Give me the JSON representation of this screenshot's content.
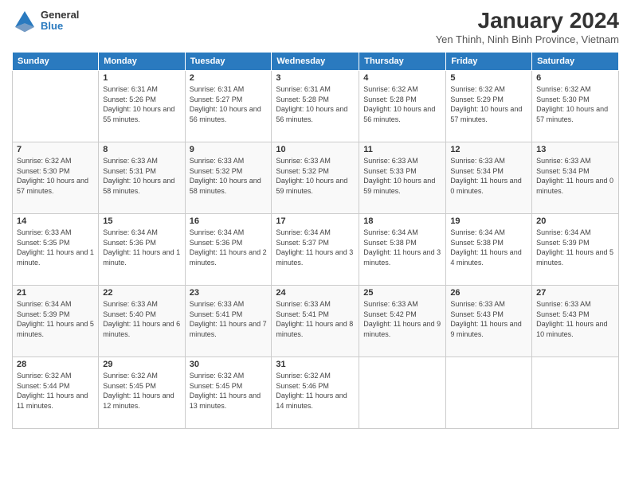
{
  "logo": {
    "general": "General",
    "blue": "Blue"
  },
  "header": {
    "title": "January 2024",
    "location": "Yen Thinh, Ninh Binh Province, Vietnam"
  },
  "days_of_week": [
    "Sunday",
    "Monday",
    "Tuesday",
    "Wednesday",
    "Thursday",
    "Friday",
    "Saturday"
  ],
  "weeks": [
    [
      {
        "day": "",
        "sunrise": "",
        "sunset": "",
        "daylight": ""
      },
      {
        "day": "1",
        "sunrise": "Sunrise: 6:31 AM",
        "sunset": "Sunset: 5:26 PM",
        "daylight": "Daylight: 10 hours and 55 minutes."
      },
      {
        "day": "2",
        "sunrise": "Sunrise: 6:31 AM",
        "sunset": "Sunset: 5:27 PM",
        "daylight": "Daylight: 10 hours and 56 minutes."
      },
      {
        "day": "3",
        "sunrise": "Sunrise: 6:31 AM",
        "sunset": "Sunset: 5:28 PM",
        "daylight": "Daylight: 10 hours and 56 minutes."
      },
      {
        "day": "4",
        "sunrise": "Sunrise: 6:32 AM",
        "sunset": "Sunset: 5:28 PM",
        "daylight": "Daylight: 10 hours and 56 minutes."
      },
      {
        "day": "5",
        "sunrise": "Sunrise: 6:32 AM",
        "sunset": "Sunset: 5:29 PM",
        "daylight": "Daylight: 10 hours and 57 minutes."
      },
      {
        "day": "6",
        "sunrise": "Sunrise: 6:32 AM",
        "sunset": "Sunset: 5:30 PM",
        "daylight": "Daylight: 10 hours and 57 minutes."
      }
    ],
    [
      {
        "day": "7",
        "sunrise": "Sunrise: 6:32 AM",
        "sunset": "Sunset: 5:30 PM",
        "daylight": "Daylight: 10 hours and 57 minutes."
      },
      {
        "day": "8",
        "sunrise": "Sunrise: 6:33 AM",
        "sunset": "Sunset: 5:31 PM",
        "daylight": "Daylight: 10 hours and 58 minutes."
      },
      {
        "day": "9",
        "sunrise": "Sunrise: 6:33 AM",
        "sunset": "Sunset: 5:32 PM",
        "daylight": "Daylight: 10 hours and 58 minutes."
      },
      {
        "day": "10",
        "sunrise": "Sunrise: 6:33 AM",
        "sunset": "Sunset: 5:32 PM",
        "daylight": "Daylight: 10 hours and 59 minutes."
      },
      {
        "day": "11",
        "sunrise": "Sunrise: 6:33 AM",
        "sunset": "Sunset: 5:33 PM",
        "daylight": "Daylight: 10 hours and 59 minutes."
      },
      {
        "day": "12",
        "sunrise": "Sunrise: 6:33 AM",
        "sunset": "Sunset: 5:34 PM",
        "daylight": "Daylight: 11 hours and 0 minutes."
      },
      {
        "day": "13",
        "sunrise": "Sunrise: 6:33 AM",
        "sunset": "Sunset: 5:34 PM",
        "daylight": "Daylight: 11 hours and 0 minutes."
      }
    ],
    [
      {
        "day": "14",
        "sunrise": "Sunrise: 6:33 AM",
        "sunset": "Sunset: 5:35 PM",
        "daylight": "Daylight: 11 hours and 1 minute."
      },
      {
        "day": "15",
        "sunrise": "Sunrise: 6:34 AM",
        "sunset": "Sunset: 5:36 PM",
        "daylight": "Daylight: 11 hours and 1 minute."
      },
      {
        "day": "16",
        "sunrise": "Sunrise: 6:34 AM",
        "sunset": "Sunset: 5:36 PM",
        "daylight": "Daylight: 11 hours and 2 minutes."
      },
      {
        "day": "17",
        "sunrise": "Sunrise: 6:34 AM",
        "sunset": "Sunset: 5:37 PM",
        "daylight": "Daylight: 11 hours and 3 minutes."
      },
      {
        "day": "18",
        "sunrise": "Sunrise: 6:34 AM",
        "sunset": "Sunset: 5:38 PM",
        "daylight": "Daylight: 11 hours and 3 minutes."
      },
      {
        "day": "19",
        "sunrise": "Sunrise: 6:34 AM",
        "sunset": "Sunset: 5:38 PM",
        "daylight": "Daylight: 11 hours and 4 minutes."
      },
      {
        "day": "20",
        "sunrise": "Sunrise: 6:34 AM",
        "sunset": "Sunset: 5:39 PM",
        "daylight": "Daylight: 11 hours and 5 minutes."
      }
    ],
    [
      {
        "day": "21",
        "sunrise": "Sunrise: 6:34 AM",
        "sunset": "Sunset: 5:39 PM",
        "daylight": "Daylight: 11 hours and 5 minutes."
      },
      {
        "day": "22",
        "sunrise": "Sunrise: 6:33 AM",
        "sunset": "Sunset: 5:40 PM",
        "daylight": "Daylight: 11 hours and 6 minutes."
      },
      {
        "day": "23",
        "sunrise": "Sunrise: 6:33 AM",
        "sunset": "Sunset: 5:41 PM",
        "daylight": "Daylight: 11 hours and 7 minutes."
      },
      {
        "day": "24",
        "sunrise": "Sunrise: 6:33 AM",
        "sunset": "Sunset: 5:41 PM",
        "daylight": "Daylight: 11 hours and 8 minutes."
      },
      {
        "day": "25",
        "sunrise": "Sunrise: 6:33 AM",
        "sunset": "Sunset: 5:42 PM",
        "daylight": "Daylight: 11 hours and 9 minutes."
      },
      {
        "day": "26",
        "sunrise": "Sunrise: 6:33 AM",
        "sunset": "Sunset: 5:43 PM",
        "daylight": "Daylight: 11 hours and 9 minutes."
      },
      {
        "day": "27",
        "sunrise": "Sunrise: 6:33 AM",
        "sunset": "Sunset: 5:43 PM",
        "daylight": "Daylight: 11 hours and 10 minutes."
      }
    ],
    [
      {
        "day": "28",
        "sunrise": "Sunrise: 6:32 AM",
        "sunset": "Sunset: 5:44 PM",
        "daylight": "Daylight: 11 hours and 11 minutes."
      },
      {
        "day": "29",
        "sunrise": "Sunrise: 6:32 AM",
        "sunset": "Sunset: 5:45 PM",
        "daylight": "Daylight: 11 hours and 12 minutes."
      },
      {
        "day": "30",
        "sunrise": "Sunrise: 6:32 AM",
        "sunset": "Sunset: 5:45 PM",
        "daylight": "Daylight: 11 hours and 13 minutes."
      },
      {
        "day": "31",
        "sunrise": "Sunrise: 6:32 AM",
        "sunset": "Sunset: 5:46 PM",
        "daylight": "Daylight: 11 hours and 14 minutes."
      },
      {
        "day": "",
        "sunrise": "",
        "sunset": "",
        "daylight": ""
      },
      {
        "day": "",
        "sunrise": "",
        "sunset": "",
        "daylight": ""
      },
      {
        "day": "",
        "sunrise": "",
        "sunset": "",
        "daylight": ""
      }
    ]
  ]
}
